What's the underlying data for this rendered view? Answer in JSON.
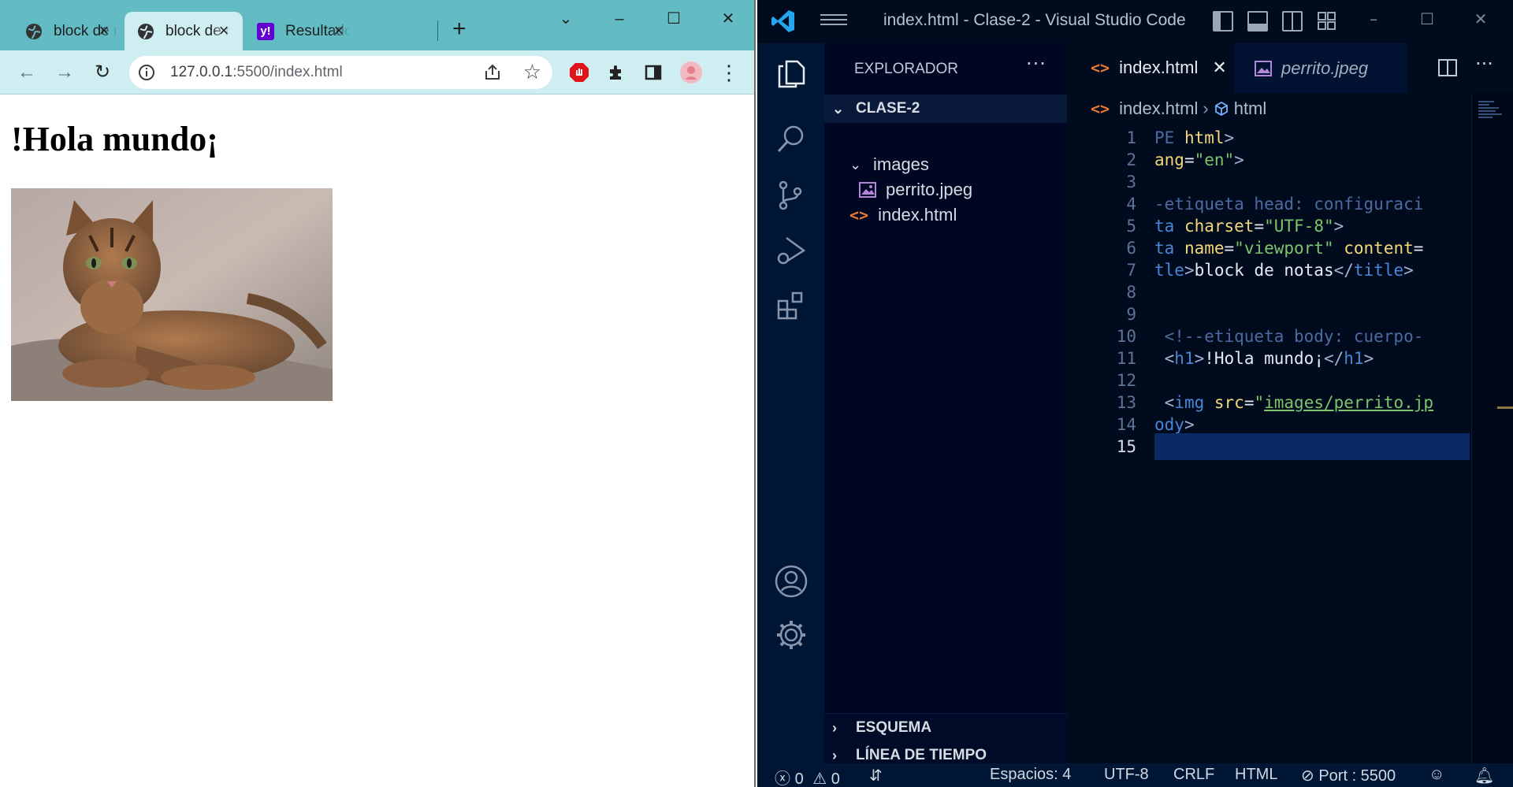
{
  "browser": {
    "tabs": [
      {
        "title": "block de notas",
        "favicon": "globe-icon",
        "active": false
      },
      {
        "title": "block de notas",
        "favicon": "globe-icon",
        "active": true
      },
      {
        "title": "Resultados",
        "favicon": "yahoo-icon",
        "active": false
      }
    ],
    "yahoo_badge": "y!",
    "url_host": "127.0.0.1",
    "url_rest": ":5500/index.html",
    "page": {
      "heading": "!Hola mundo¡",
      "image": "cat-photo"
    }
  },
  "vscode": {
    "window_title": "index.html - Clase-2 - Visual Studio Code",
    "explorer": {
      "header": "EXPLORADOR",
      "project": "CLASE-2",
      "items": [
        {
          "label": "images",
          "type": "folder"
        },
        {
          "label": "perrito.jpeg",
          "type": "image"
        },
        {
          "label": "index.html",
          "type": "html"
        }
      ],
      "sections": [
        "ESQUEMA",
        "LÍNEA DE TIEMPO"
      ]
    },
    "editor_tabs": [
      {
        "label": "index.html",
        "active": true
      },
      {
        "label": "perrito.jpeg",
        "active": false
      }
    ],
    "breadcrumb": [
      "index.html",
      "html"
    ],
    "line_numbers": [
      "1",
      "2",
      "3",
      "4",
      "5",
      "6",
      "7",
      "8",
      "9",
      "10",
      "11",
      "12",
      "13",
      "14",
      "15"
    ],
    "code": {
      "l1a": "PE ",
      "l1b": "html",
      "l1c": ">",
      "l2a": "ang",
      "l2b": "=",
      "l2c": "\"en\"",
      "l2d": ">",
      "l4": "-etiqueta head: configuraci",
      "l5a": "ta ",
      "l5b": "charset",
      "l5c": "=",
      "l5d": "\"UTF-8\"",
      "l5e": ">",
      "l6a": "ta ",
      "l6b": "name",
      "l6c": "=",
      "l6d": "\"viewport\"",
      "l6e": " content",
      "l6f": "=",
      "l7a": "tle",
      "l7b": ">",
      "l7c": "block de notas",
      "l7d": "</",
      "l7e": "title",
      "l7f": ">",
      "l10": " <!--etiqueta body: cuerpo-",
      "l11a": " <",
      "l11b": "h1",
      "l11c": ">",
      "l11d": "!Hola mundo¡",
      "l11e": "</",
      "l11f": "h1",
      "l11g": ">",
      "l13a": " <",
      "l13b": "img",
      "l13c": " src",
      "l13d": "=",
      "l13e": "\"",
      "l13f": "images/perrito.jp",
      "l14a": "ody",
      "l14b": ">"
    },
    "status": {
      "errors": "0",
      "warnings": "0",
      "spaces": "Espacios: 4",
      "encoding": "UTF-8",
      "eol": "CRLF",
      "language": "HTML",
      "port": "Port : 5500"
    }
  }
}
